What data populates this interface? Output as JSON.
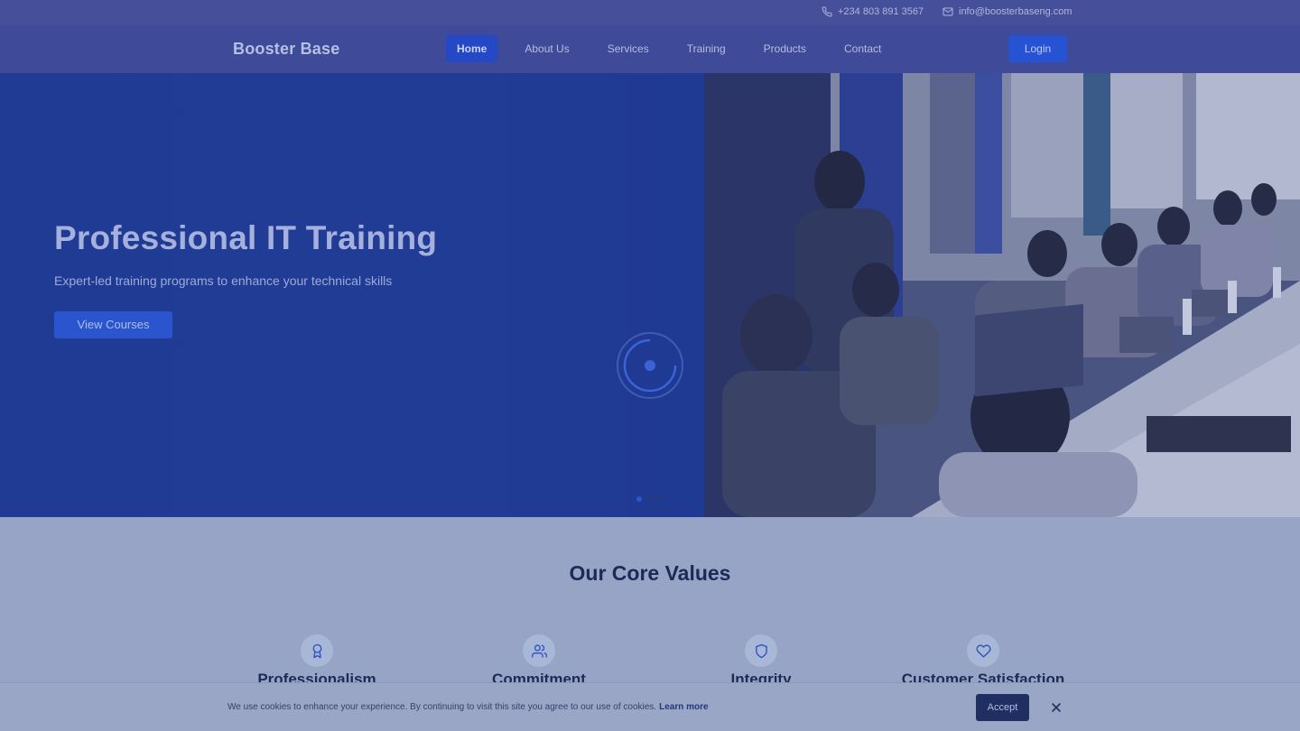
{
  "topbar": {
    "phone": "+234 803 891 3567",
    "email": "info@boosterbaseng.com",
    "phone_icon": "phone-icon",
    "email_icon": "mail-icon"
  },
  "nav": {
    "brand": "Booster Base",
    "items": [
      {
        "label": "Home",
        "active": true
      },
      {
        "label": "About Us",
        "active": false
      },
      {
        "label": "Services",
        "active": false
      },
      {
        "label": "Training",
        "active": false
      },
      {
        "label": "Products",
        "active": false
      },
      {
        "label": "Contact",
        "active": false
      }
    ],
    "login_label": "Login"
  },
  "hero": {
    "title": "Professional IT Training",
    "subtitle": "Expert-led training programs to enhance your technical skills",
    "cta_label": "View Courses",
    "image": "Group of trainees working on laptops at long tables in a classroom",
    "slide_count": 3,
    "active_slide": 1
  },
  "core_values": {
    "title": "Our Core Values",
    "items": [
      {
        "name": "Professionalism",
        "icon": "award-icon"
      },
      {
        "name": "Commitment",
        "icon": "users-icon"
      },
      {
        "name": "Integrity",
        "icon": "shield-icon"
      },
      {
        "name": "Customer Satisfaction",
        "icon": "heart-icon"
      }
    ]
  },
  "cookie_banner": {
    "text": "We use cookies to enhance your experience. By continuing to visit this site you agree to our use of cookies.",
    "link_label": "Learn more",
    "accept_label": "Accept",
    "close_icon": "close-icon"
  },
  "colors": {
    "accent": "#2553d4",
    "nav_bg": "#3f4a98",
    "hero_bg": "#1f3890",
    "values_bg": "#98a4c5",
    "heading": "#1b2a57"
  }
}
